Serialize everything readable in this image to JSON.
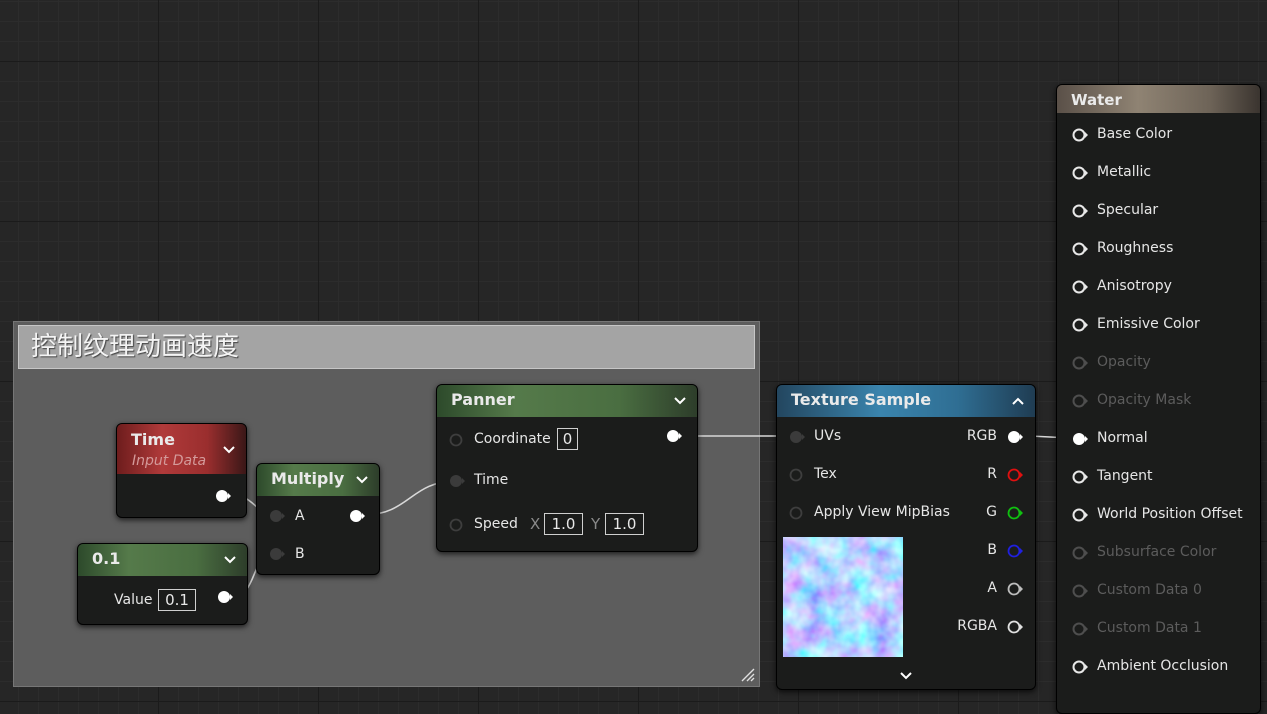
{
  "comment": {
    "title": "控制纹理动画速度"
  },
  "time_node": {
    "title": "Time",
    "subtitle": "Input Data"
  },
  "const_node": {
    "title": "0.1",
    "value_label": "Value",
    "value": "0.1"
  },
  "multiply_node": {
    "title": "Multiply",
    "input_a": "A",
    "input_b": "B"
  },
  "panner_node": {
    "title": "Panner",
    "coordinate_label": "Coordinate",
    "coordinate_value": "0",
    "time_label": "Time",
    "speed_label": "Speed",
    "speed_x_axis": "X",
    "speed_x": "1.0",
    "speed_y_axis": "Y",
    "speed_y": "1.0"
  },
  "texture_node": {
    "title": "Texture Sample",
    "inputs": [
      "UVs",
      "Tex",
      "Apply View MipBias"
    ],
    "outputs": [
      "RGB",
      "R",
      "G",
      "B",
      "A",
      "RGBA"
    ]
  },
  "water_node": {
    "title": "Water",
    "pins": [
      {
        "label": "Base Color",
        "enabled": true
      },
      {
        "label": "Metallic",
        "enabled": true
      },
      {
        "label": "Specular",
        "enabled": true
      },
      {
        "label": "Roughness",
        "enabled": true
      },
      {
        "label": "Anisotropy",
        "enabled": true
      },
      {
        "label": "Emissive Color",
        "enabled": true
      },
      {
        "label": "Opacity",
        "enabled": false
      },
      {
        "label": "Opacity Mask",
        "enabled": false
      },
      {
        "label": "Normal",
        "enabled": true
      },
      {
        "label": "Tangent",
        "enabled": true
      },
      {
        "label": "World Position Offset",
        "enabled": true
      },
      {
        "label": "Subsurface Color",
        "enabled": false
      },
      {
        "label": "Custom Data 0",
        "enabled": false
      },
      {
        "label": "Custom Data 1",
        "enabled": false
      },
      {
        "label": "Ambient Occlusion",
        "enabled": true
      }
    ]
  },
  "colors": {
    "wire": "#e0e0e0",
    "pin_r": "#e01010",
    "pin_g": "#10c010",
    "pin_b": "#2020e0"
  }
}
